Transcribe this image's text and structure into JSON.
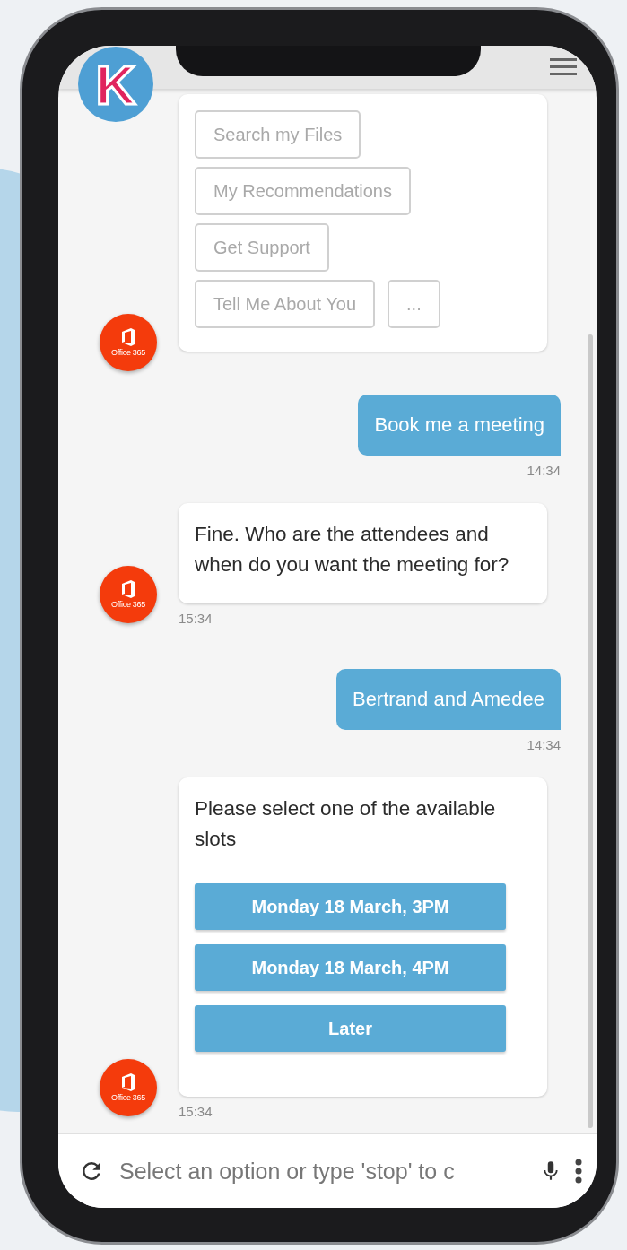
{
  "header": {
    "logo_letter": "K"
  },
  "messages": [
    {
      "kind": "bot_options",
      "avatar_label": "Office 365",
      "options": [
        [
          "Search my Files"
        ],
        [
          "My Recommendations"
        ],
        [
          "Get Support"
        ],
        [
          "Tell Me About You",
          "..."
        ]
      ]
    },
    {
      "kind": "user",
      "text": "Book me a meeting",
      "time": "14:34"
    },
    {
      "kind": "bot_text",
      "avatar_label": "Office 365",
      "text": "Fine. Who are the attendees and when do you want the meeting for?",
      "time": "15:34"
    },
    {
      "kind": "user",
      "text": "Bertrand and Amedee",
      "time": "14:34"
    },
    {
      "kind": "bot_slots",
      "avatar_label": "Office 365",
      "text": "Please select one of the available slots",
      "slots": [
        "Monday 18 March, 3PM",
        "Monday 18 March, 4PM",
        "Later"
      ],
      "time": "15:34"
    }
  ],
  "input": {
    "placeholder": "Select an option or type 'stop' to c"
  }
}
